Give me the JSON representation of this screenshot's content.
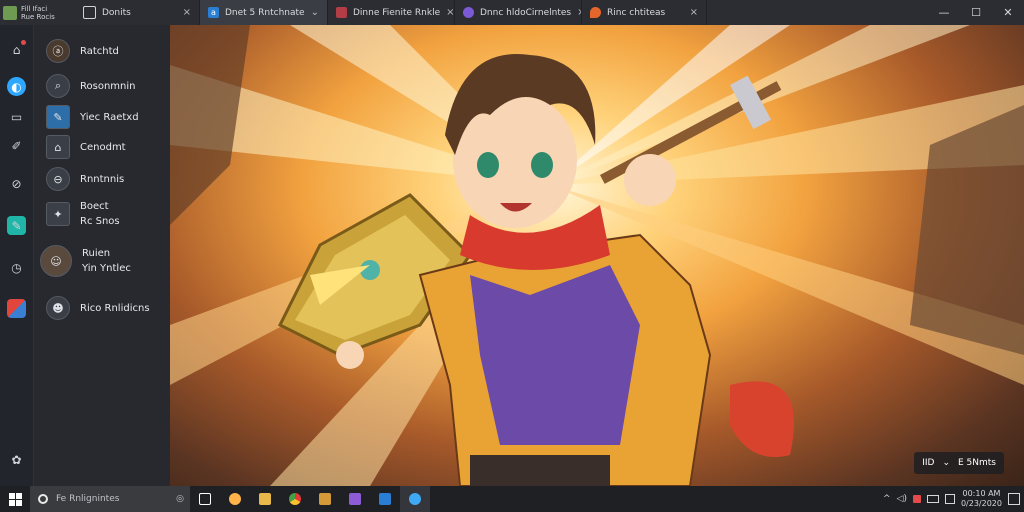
{
  "app": {
    "badge_line1": "Fill Ifaci",
    "badge_line2": "Rue Rocis"
  },
  "tabs": [
    {
      "label": "Donits",
      "close": "×"
    },
    {
      "label": "Dnet 5 Rntchnate",
      "chev": "⌄"
    },
    {
      "label": "Dinne Fienite Rnkle",
      "close": "×"
    },
    {
      "label": "Dnnc hldoCirnelntes",
      "close": "×"
    },
    {
      "label": "Rinc chtiteas",
      "close": "×"
    }
  ],
  "window_controls": {
    "minimize": "—",
    "maximize": "☐",
    "close": "✕"
  },
  "rail": {
    "icons": [
      "home-icon",
      "app-icon",
      "library-icon",
      "tool-icon",
      "link-icon",
      "edit-icon",
      "clock-icon",
      "flag-icon",
      "settings-icon"
    ]
  },
  "sidebar": {
    "items": [
      {
        "label": "Ratchtd",
        "icon": "ⓐ"
      },
      {
        "label": "Rosonmnin",
        "icon": "⌕"
      },
      {
        "label": "Yiec Raetxd",
        "icon": "✎"
      },
      {
        "label": "Cenodmt",
        "icon": "⌂"
      },
      {
        "label": "Rnntnnis",
        "icon": "⊖"
      },
      {
        "label1": "Boect",
        "label2": "Rc Snos",
        "icon": "✦"
      },
      {
        "label1": "Ruien",
        "label2": "Yin Yntlec",
        "icon": "☺"
      },
      {
        "label": "Rico Rnlidicns",
        "icon": "☻"
      }
    ]
  },
  "player": {
    "left": "IID",
    "sep": "⌄",
    "right": "E 5Nmts"
  },
  "taskbar": {
    "search_placeholder": "Fe Rnlignintes",
    "apps": [
      {
        "name": "task-view",
        "color": "#ffffff"
      },
      {
        "name": "app-orange",
        "color": "#ffb34a"
      },
      {
        "name": "file-explorer",
        "color": "#e8b84a"
      },
      {
        "name": "chrome",
        "color": "#4caf50"
      },
      {
        "name": "store",
        "color": "#d49a3a"
      },
      {
        "name": "app-purple",
        "color": "#8e5bd6"
      },
      {
        "name": "app-blue",
        "color": "#2a7fd4"
      },
      {
        "name": "app-active",
        "color": "#3fa9f5"
      }
    ],
    "tray": {
      "caret": "^",
      "speaker": "🔊",
      "clock_line1": "00:10 AM",
      "clock_line2": "0/23/2020"
    }
  }
}
